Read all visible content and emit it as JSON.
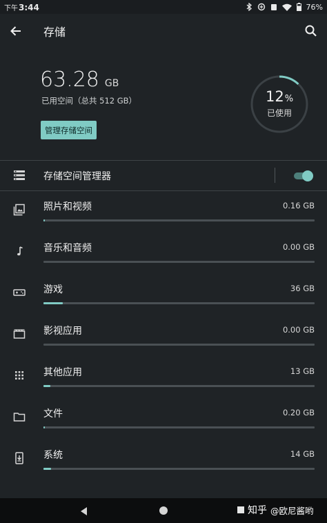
{
  "status_bar": {
    "time_prefix": "下午",
    "time": "3:44",
    "battery": "76%",
    "icons": [
      "bluetooth-icon",
      "data-saver-icon",
      "silent-icon",
      "wifi-icon",
      "battery-icon"
    ]
  },
  "header": {
    "title": "存储",
    "back_icon": "arrow-back-icon",
    "search_icon": "search-icon"
  },
  "summary": {
    "used_value": "63.28",
    "used_unit": "GB",
    "used_subtitle": "已用空间（总共 512 GB）",
    "manage_button": "管理存储空间",
    "percent_value": "12",
    "percent_sign": "%",
    "percent_fraction": 0.12,
    "percent_label": "已使用"
  },
  "storage_manager": {
    "label": "存储空间管理器",
    "icon": "storage-icon",
    "enabled": true
  },
  "categories": [
    {
      "label": "照片和视频",
      "size": "0.16 GB",
      "fraction": 0.005,
      "icon": "photo-icon"
    },
    {
      "label": "音乐和音频",
      "size": "0.00 GB",
      "fraction": 0.0,
      "icon": "music-note-icon"
    },
    {
      "label": "游戏",
      "size": "36 GB",
      "fraction": 0.07,
      "icon": "gamepad-icon"
    },
    {
      "label": "影视应用",
      "size": "0.00 GB",
      "fraction": 0.0,
      "icon": "movie-icon"
    },
    {
      "label": "其他应用",
      "size": "13 GB",
      "fraction": 0.025,
      "icon": "apps-grid-icon"
    },
    {
      "label": "文件",
      "size": "0.20 GB",
      "fraction": 0.005,
      "icon": "folder-icon"
    },
    {
      "label": "系统",
      "size": "14 GB",
      "fraction": 0.027,
      "icon": "system-update-icon"
    }
  ],
  "nav_bar": {
    "back_icon": "nav-back-icon",
    "home_icon": "nav-home-icon"
  },
  "watermark": {
    "site": "知乎",
    "handle": "@欧尼酱哟"
  },
  "colors": {
    "accent": "#80cbc4",
    "background": "#1f2326",
    "track": "#4a5054"
  }
}
